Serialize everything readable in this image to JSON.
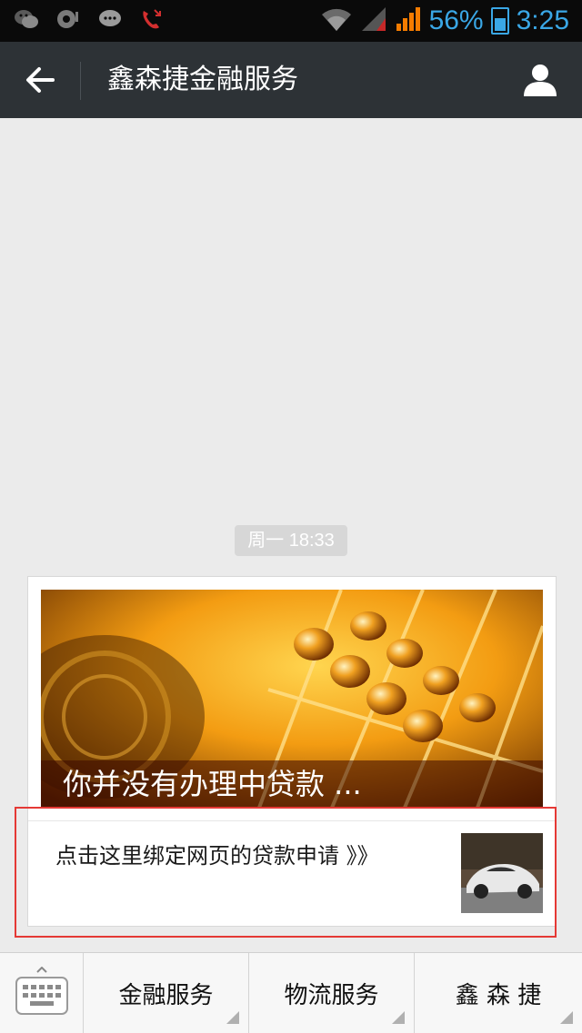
{
  "status_bar": {
    "battery_percent": "56%",
    "time": "3:25",
    "icons_left": [
      "wechat-icon",
      "message-icon",
      "chat-bubble-icon",
      "missed-call-icon"
    ],
    "icons_right": [
      "wifi-icon",
      "signal-icon",
      "signal-icon",
      "battery-icon"
    ],
    "accent_color": "#3aa7e6"
  },
  "header": {
    "title": "鑫森捷金融服务",
    "back_icon": "arrow-left-icon",
    "profile_icon": "person-icon"
  },
  "chat": {
    "timestamp": "周一 18:33",
    "news_card": {
      "cover_title": "你并没有办理中贷款 ...",
      "sub_item_title": "点击这里绑定网页的贷款申请 》》"
    },
    "highlight_color": "#e53935"
  },
  "bottom_menu": {
    "keyboard_icon": "keyboard-icon",
    "items": [
      {
        "label": "金融服务"
      },
      {
        "label": "物流服务"
      },
      {
        "label": "鑫 森 捷"
      }
    ]
  }
}
